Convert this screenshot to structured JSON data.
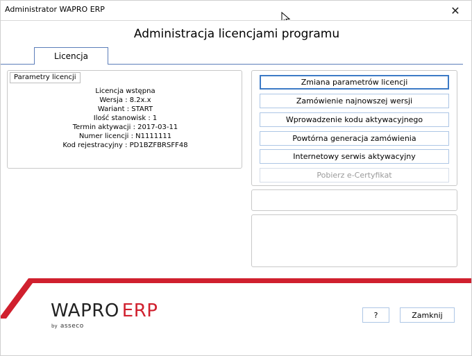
{
  "window": {
    "title": "Administrator WAPRO ERP",
    "close_glyph": "✕"
  },
  "header": {
    "title": "Administracja licencjami programu"
  },
  "tabs": [
    {
      "label": "Licencja",
      "active": true
    }
  ],
  "license_params": {
    "group_label": "Parametry licencji",
    "lines": [
      "Licencja wstępna",
      "Wersja : 8.2x.x",
      "Wariant : START",
      "Ilość stanowisk : 1",
      "Termin aktywacji : 2017-03-11",
      "Numer licencji : N1111111",
      "Kod rejestracyjny : PD1BZFBRSFF48"
    ]
  },
  "actions": [
    {
      "label": "Zmiana parametrów licencji",
      "state": "primary"
    },
    {
      "label": "Zamówienie najnowszej wersji",
      "state": "normal"
    },
    {
      "label": "Wprowadzenie kodu aktywacyjnego",
      "state": "normal"
    },
    {
      "label": "Powtórna generacja zamówienia",
      "state": "normal"
    },
    {
      "label": "Internetowy serwis aktywacyjny",
      "state": "normal"
    },
    {
      "label": "Pobierz e-Certyfikat",
      "state": "disabled"
    }
  ],
  "logo": {
    "brand": "WAPRO",
    "product": "ERP",
    "by": "by",
    "company": "asseco"
  },
  "footer": {
    "help_label": "?",
    "close_label": "Zamknij"
  },
  "colors": {
    "accent_red": "#d0202e",
    "tab_blue": "#5b7db9",
    "button_border": "#adc6e5"
  }
}
